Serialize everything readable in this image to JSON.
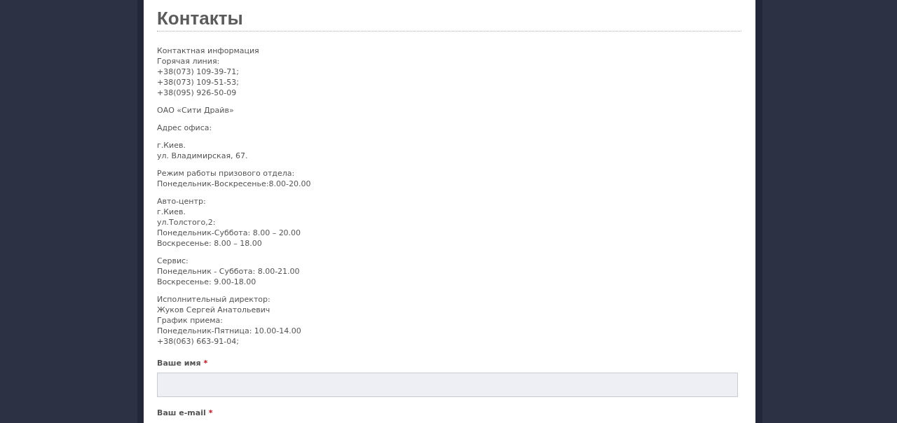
{
  "title": "Контакты",
  "paragraphs": [
    {
      "lines": [
        "Контактная информация",
        "Горячая линия:",
        "+38(073) 109-39-71;",
        "+38(073) 109-51-53;",
        "+38(095) 926-50-09"
      ]
    },
    {
      "lines": [
        "ОАО «Сити Драйв»"
      ]
    },
    {
      "lines": [
        "Адрес офиса:"
      ]
    },
    {
      "lines": [
        "г.Киев.",
        "ул. Владимирская, 67."
      ]
    },
    {
      "lines": [
        "Режим работы призового отдела:",
        "Понедельник-Воскресенье:8.00-20.00"
      ]
    },
    {
      "lines": [
        "Авто-центр:",
        "г.Киев.",
        "ул.Толстого,2:",
        "Понедельник-Суббота: 8.00 – 20.00",
        "Воскресенье: 8.00 – 18.00"
      ]
    },
    {
      "lines": [
        "Сервис:",
        "Понедельник - Суббота: 8.00-21.00",
        "Воскресенье: 9.00-18.00"
      ]
    },
    {
      "lines": [
        "Исполнительный директор:",
        "Жуков Сергей Анатольевич",
        "График приема:",
        "Понедельник-Пятница: 10.00-14.00",
        "+38(063) 663-91-04;"
      ]
    }
  ],
  "form": {
    "items": [
      {
        "kind": "label",
        "text": "Ваше имя",
        "marker": "*"
      },
      {
        "kind": "input"
      },
      {
        "kind": "label",
        "text": "Ваш e-mail",
        "marker": "*"
      }
    ]
  }
}
